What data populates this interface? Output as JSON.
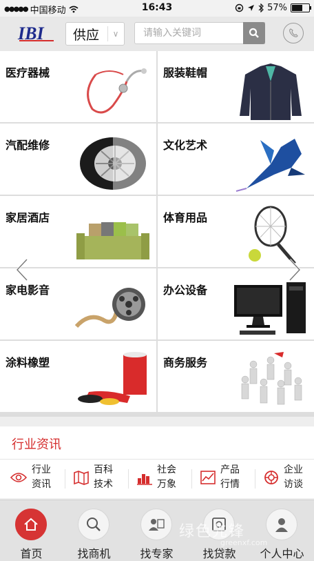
{
  "status_bar": {
    "carrier": "中国移动",
    "time": "16:43",
    "battery": "57%"
  },
  "header": {
    "logo": "IBI",
    "dropdown_value": "供应",
    "search_placeholder": "请输入关键词"
  },
  "categories": [
    {
      "label": "医疗器械"
    },
    {
      "label": "服装鞋帽"
    },
    {
      "label": "汽配维修"
    },
    {
      "label": "文化艺术"
    },
    {
      "label": "家居酒店"
    },
    {
      "label": "体育用品"
    },
    {
      "label": "家电影音"
    },
    {
      "label": "办公设备"
    },
    {
      "label": "涂料橡塑"
    },
    {
      "label": "商务服务"
    }
  ],
  "news": {
    "title": "行业资讯",
    "items": [
      {
        "line1": "行业",
        "line2": "资讯",
        "icon": "eye-icon"
      },
      {
        "line1": "百科",
        "line2": "技术",
        "icon": "map-book-icon"
      },
      {
        "line1": "社会",
        "line2": "万象",
        "icon": "city-icon"
      },
      {
        "line1": "产品",
        "line2": "行情",
        "icon": "chart-line-icon"
      },
      {
        "line1": "企业",
        "line2": "访谈",
        "icon": "lifebuoy-icon"
      }
    ]
  },
  "bottom_nav": [
    {
      "label": "首页",
      "icon": "home-icon",
      "active": true
    },
    {
      "label": "找商机",
      "icon": "search-icon"
    },
    {
      "label": "找专家",
      "icon": "expert-icon"
    },
    {
      "label": "找贷款",
      "icon": "loan-icon"
    },
    {
      "label": "个人中心",
      "icon": "user-icon"
    }
  ],
  "watermark": {
    "text": "绿色先锋",
    "sub": "greenxf.com"
  },
  "colors": {
    "accent": "#d63434",
    "header_bg": "#e8e8e8"
  }
}
